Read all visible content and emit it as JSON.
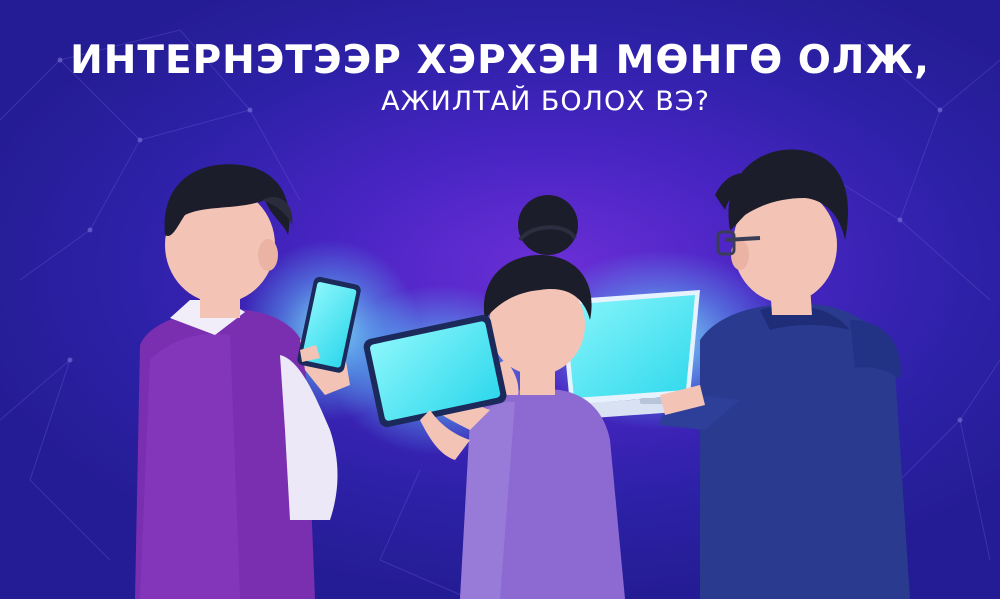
{
  "headline": {
    "line1": "ИНТЕРНЭТЭЭР ХЭРХЭН МӨНГӨ ОЛЖ,",
    "line2": "АЖИЛТАЙ БОЛОХ ВЭ?"
  },
  "colors": {
    "background": "#2d21a8",
    "glow": "#6b2fd6",
    "screen": "#48e6f2",
    "hair": "#1c1d2a",
    "skin": "#f3c4b6"
  }
}
